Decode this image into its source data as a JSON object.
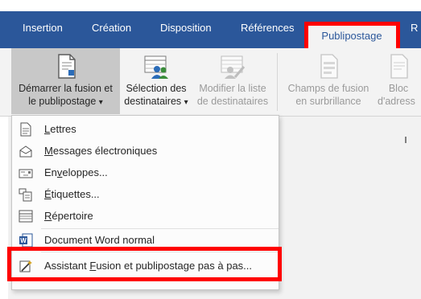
{
  "tabs": {
    "insertion": "Insertion",
    "creation": "Création",
    "disposition": "Disposition",
    "references": "Références",
    "publipostage": "Publipostage",
    "partial_r": "R"
  },
  "ribbon": {
    "start_merge": {
      "line1": "Démarrer la fusion et",
      "line2": "le publipostage",
      "arrow": "▾",
      "icon": "document-merge-icon"
    },
    "select_recipients": {
      "line1": "Sélection des",
      "line2": "destinataires",
      "arrow": "▾",
      "icon": "recipients-icon"
    },
    "edit_list": {
      "line1": "Modifier la liste",
      "line2": "de destinataires",
      "icon": "edit-list-icon"
    },
    "highlight_fields": {
      "line1": "Champs de fusion",
      "line2": "en surbrillance",
      "icon": "highlight-fields-icon"
    },
    "address_block": {
      "line1": "Bloc",
      "line2": "d'adress",
      "icon": "address-block-icon"
    }
  },
  "menu": {
    "items": [
      {
        "first": "L",
        "rest": "ettres",
        "icon": "letter-icon"
      },
      {
        "first": "M",
        "rest": "essages électroniques",
        "icon": "envelope-open-icon"
      },
      {
        "first": "En",
        "ul": "v",
        "rest": "eloppes...",
        "icon": "envelope-icon"
      },
      {
        "first": "É",
        "rest": "tiquettes...",
        "icon": "labels-icon"
      },
      {
        "first": "R",
        "rest": "épertoire",
        "icon": "directory-icon"
      },
      {
        "text": "Document Word normal",
        "icon": "word-doc-icon"
      },
      {
        "pre": "Assistant ",
        "ul": "F",
        "rest": "usion et publipostage pas à pas...",
        "icon": "wizard-icon"
      }
    ]
  },
  "colors": {
    "ribbon_blue": "#2b579a",
    "highlight_red": "#ff0000"
  }
}
